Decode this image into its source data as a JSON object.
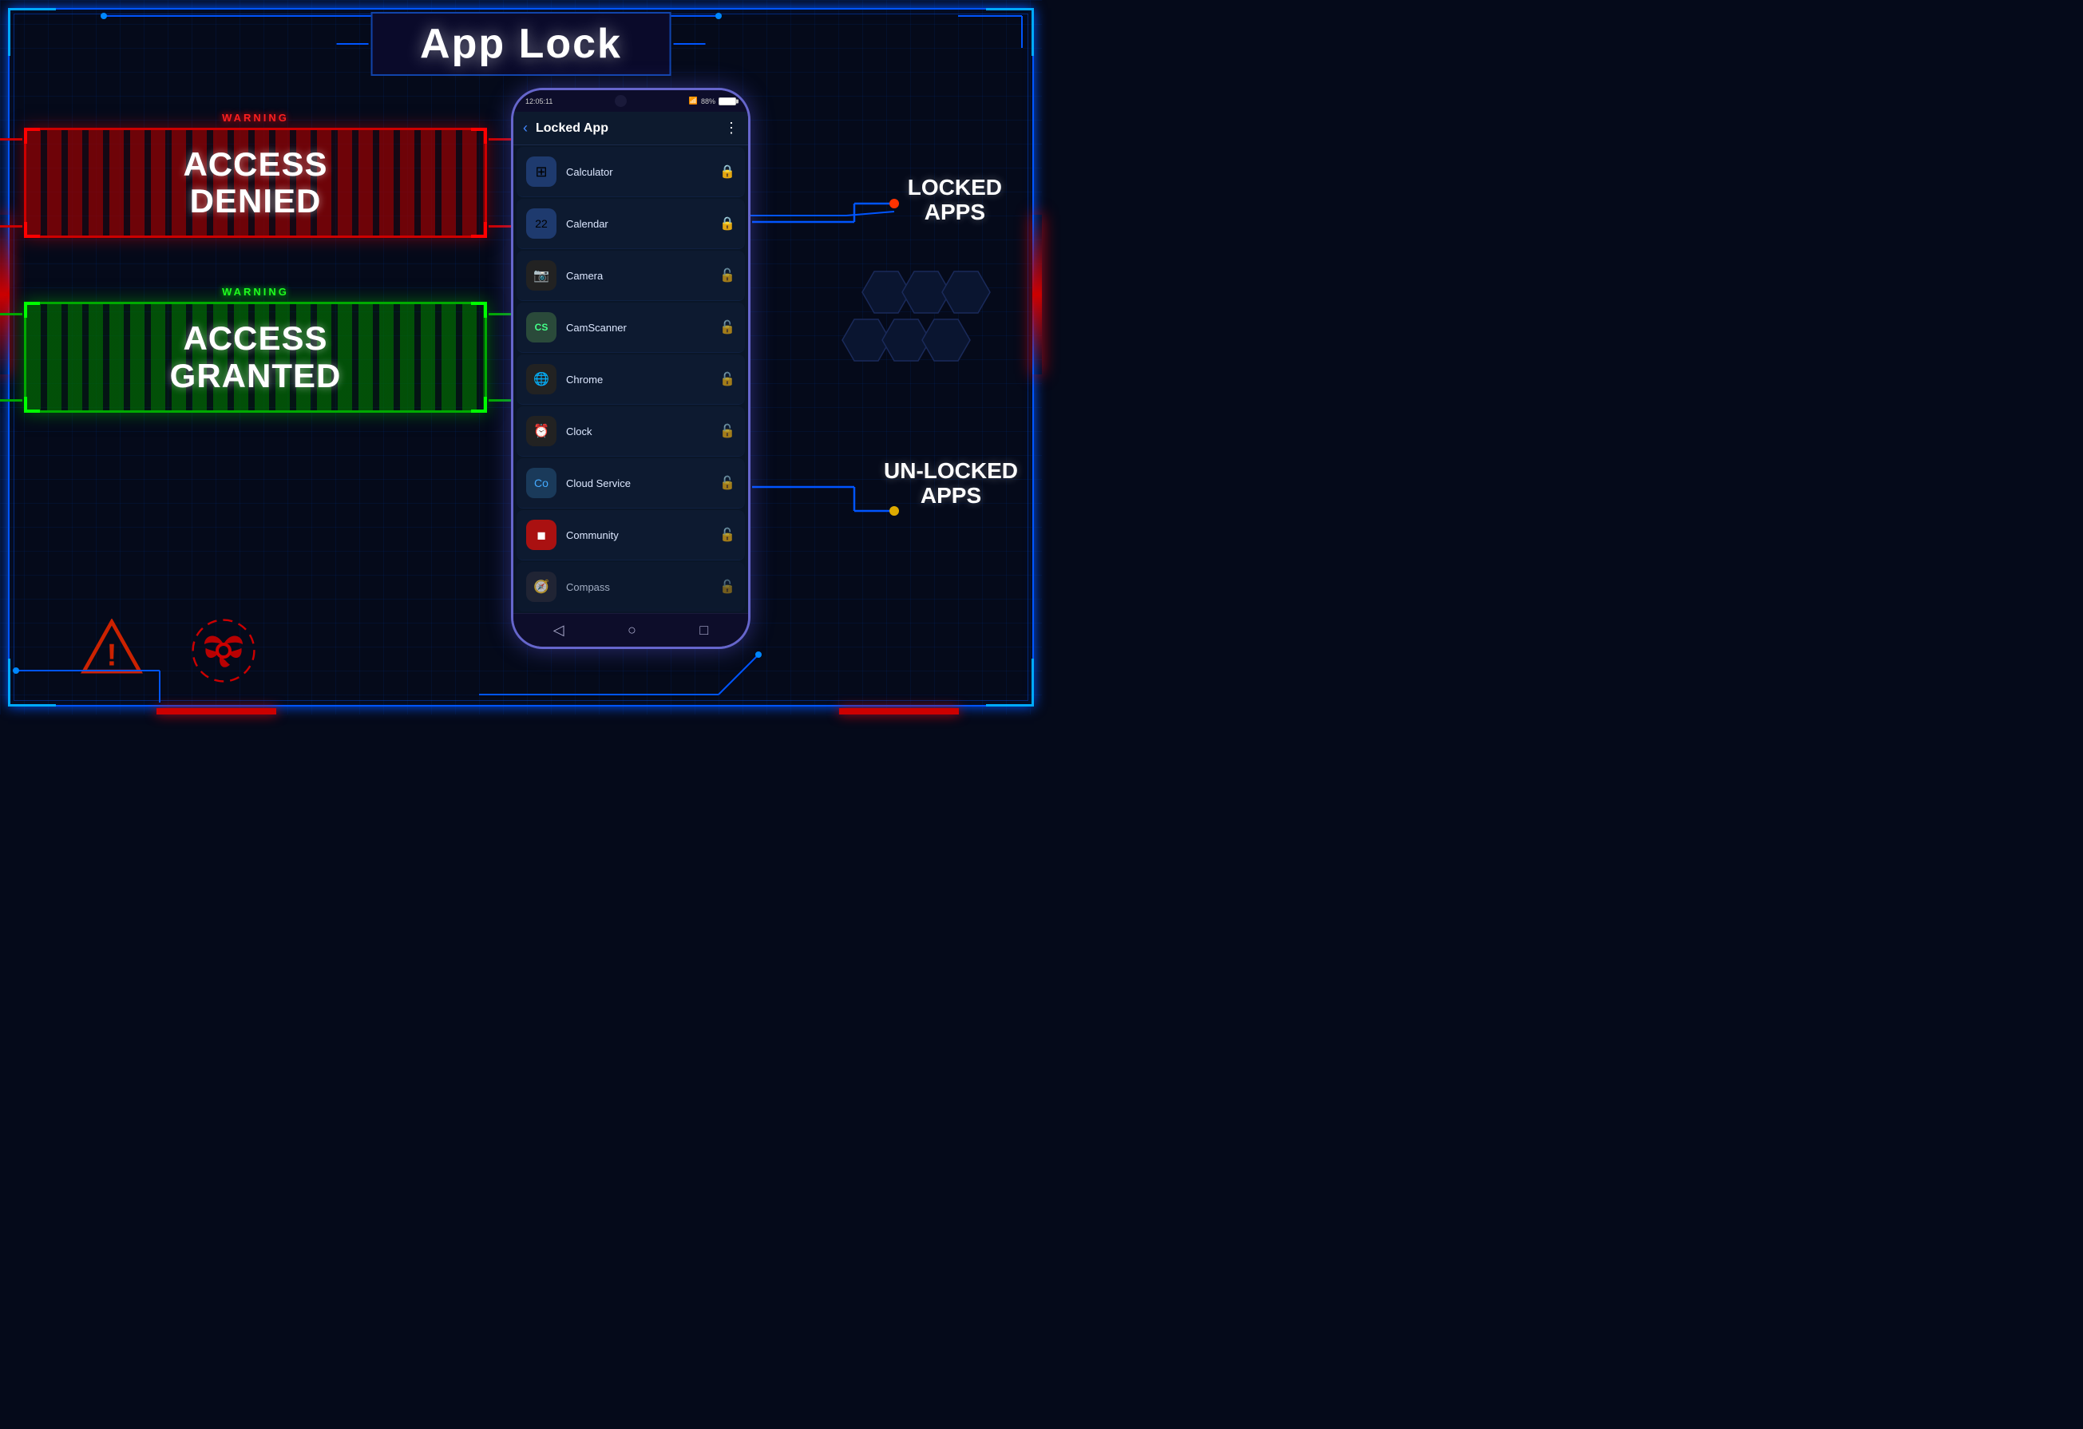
{
  "title": "App Lock",
  "header": {
    "phone_time": "12:05:11",
    "battery": "88%",
    "screen_title": "Locked App"
  },
  "access_denied": {
    "warning": "WARNING",
    "text_line1": "ACCESS",
    "text_line2": "DENIED"
  },
  "access_granted": {
    "warning": "WARNING",
    "text_line1": "ACCESS",
    "text_line2": "GRANTED"
  },
  "labels": {
    "locked_apps": "LOCKED\nAPPS",
    "locked_apps_line1": "LOCKED",
    "locked_apps_line2": "APPS",
    "unlocked_apps_line1": "UN-LOCKED",
    "unlocked_apps_line2": "APPS"
  },
  "apps": [
    {
      "name": "Calculator",
      "icon": "⊞",
      "locked": true
    },
    {
      "name": "Calendar",
      "icon": "📅",
      "locked": true
    },
    {
      "name": "Camera",
      "icon": "📷",
      "locked": false
    },
    {
      "name": "CamScanner",
      "icon": "CS",
      "locked": false
    },
    {
      "name": "Chrome",
      "icon": "◉",
      "locked": false
    },
    {
      "name": "Clock",
      "icon": "⏰",
      "locked": false
    },
    {
      "name": "Cloud Service",
      "icon": "☁",
      "locked": false
    },
    {
      "name": "Community",
      "icon": "◼",
      "locked": false
    },
    {
      "name": "Compass",
      "icon": "🧭",
      "locked": false
    }
  ],
  "nav": {
    "back": "◁",
    "home": "○",
    "recent": "□"
  }
}
